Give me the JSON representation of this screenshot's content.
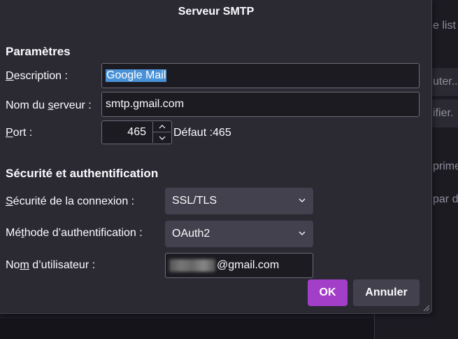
{
  "background": {
    "texts": [
      "e list",
      "uter...",
      "ifier.",
      "prime",
      "par d"
    ]
  },
  "dialog": {
    "title": "Serveur SMTP",
    "settings": {
      "heading": "Paramètres",
      "description_label_pre": "",
      "description_label_u": "D",
      "description_label_post": "escription :",
      "description_value": "Google Mail",
      "server_label_pre": "Nom du ",
      "server_label_u": "s",
      "server_label_post": "erveur :",
      "server_value": "smtp.gmail.com",
      "port_label_pre": "",
      "port_label_u": "P",
      "port_label_post": "ort :",
      "port_value": "465",
      "port_default": "Défaut :465"
    },
    "security": {
      "heading": "Sécurité et authentification",
      "connection_label_pre": "",
      "connection_label_u": "S",
      "connection_label_post": "écurité de la connexion :",
      "connection_value": "SSL/TLS",
      "auth_label_pre": "Mé",
      "auth_label_u": "t",
      "auth_label_post": "hode d’authentification :",
      "auth_value": "OAuth2",
      "username_label_pre": "No",
      "username_label_u": "m",
      "username_label_post": " d’utilisateur :",
      "username_value": "@gmail.com"
    },
    "buttons": {
      "ok": "OK",
      "cancel": "Annuler"
    }
  },
  "colors": {
    "accent": "#a33ec9",
    "selection": "#4a92d8"
  }
}
